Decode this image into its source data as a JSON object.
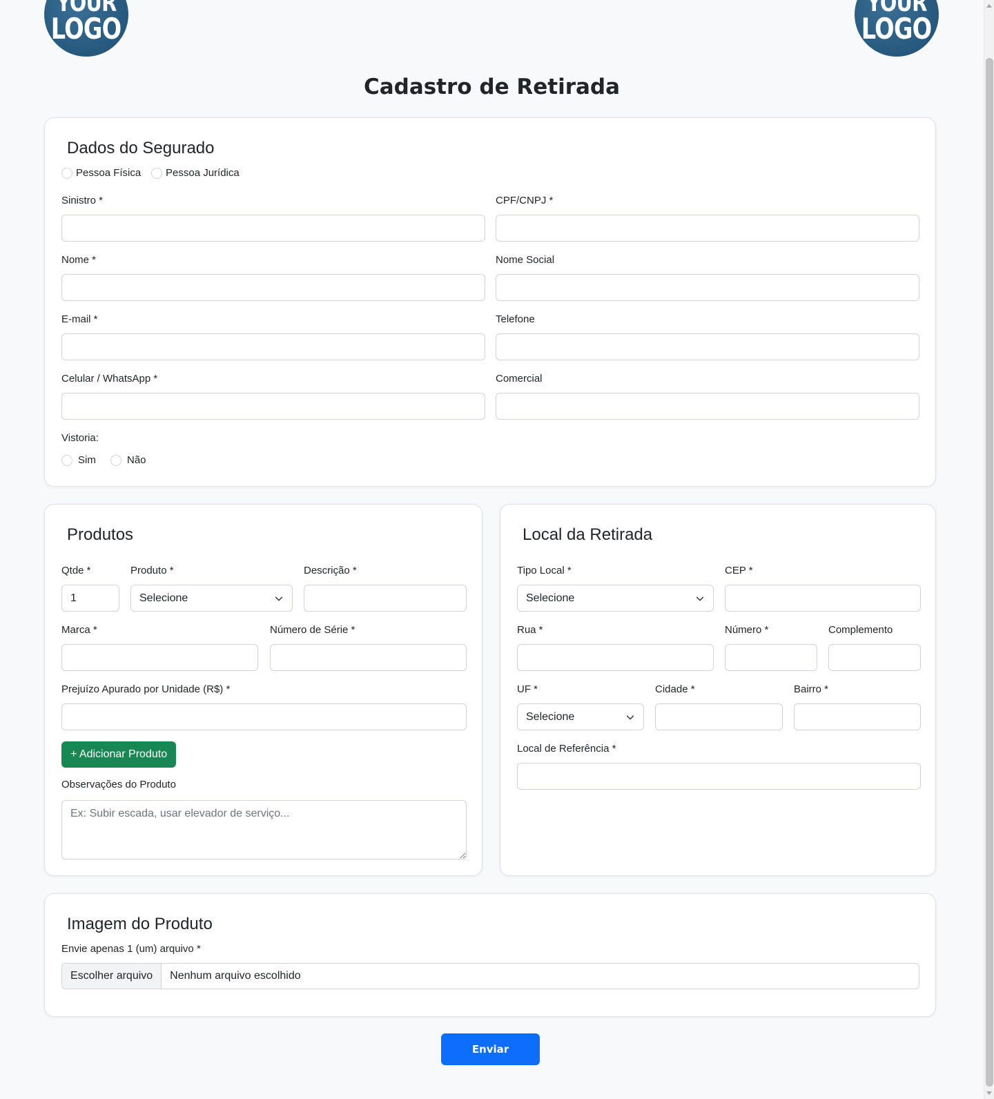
{
  "header": {
    "logo_line1": "YOUR",
    "logo_line2": "LOGO",
    "title": "Cadastro de Retirada"
  },
  "segurado": {
    "heading": "Dados do Segurado",
    "tipo_pessoa": [
      "Pessoa Física",
      "Pessoa Jurídica"
    ],
    "sinistro": "Sinistro *",
    "cpf_cnpj": "CPF/CNPJ *",
    "nome": "Nome *",
    "nome_social": "Nome Social",
    "email": "E-mail *",
    "telefone": "Telefone",
    "celular": "Celular / WhatsApp *",
    "comercial": "Comercial",
    "vistoria_label": "Vistoria:",
    "vistoria_options": [
      "Sim",
      "Não"
    ]
  },
  "produtos": {
    "heading": "Produtos",
    "qtde_label": "Qtde *",
    "qtde_value": "1",
    "produto_label": "Produto *",
    "produto_selected": "Selecione",
    "descricao_label": "Descrição *",
    "marca_label": "Marca *",
    "serie_label": "Número de Série *",
    "prejuizo_label": "Prejuízo Apurado por Unidade (R$) *",
    "add_button": "+ Adicionar Produto",
    "obs_label": "Observações do Produto",
    "obs_placeholder": "Ex: Subir escada, usar elevador de serviço..."
  },
  "local": {
    "heading": "Local da Retirada",
    "tipo_local_label": "Tipo Local *",
    "tipo_local_selected": "Selecione",
    "cep_label": "CEP *",
    "rua_label": "Rua *",
    "numero_label": "Número *",
    "complemento_label": "Complemento",
    "uf_label": "UF *",
    "uf_selected": "Selecione",
    "cidade_label": "Cidade *",
    "bairro_label": "Bairro *",
    "referencia_label": "Local de Referência *"
  },
  "imagem": {
    "heading": "Imagem do Produto",
    "hint": "Envie apenas 1 (um) arquivo *",
    "choose_button": "Escolher arquivo",
    "no_file": "Nenhum arquivo escolhido"
  },
  "submit": {
    "label": "Enviar"
  },
  "colors": {
    "primary": "#0d6efd",
    "success": "#198754",
    "logo": "#27587d"
  }
}
